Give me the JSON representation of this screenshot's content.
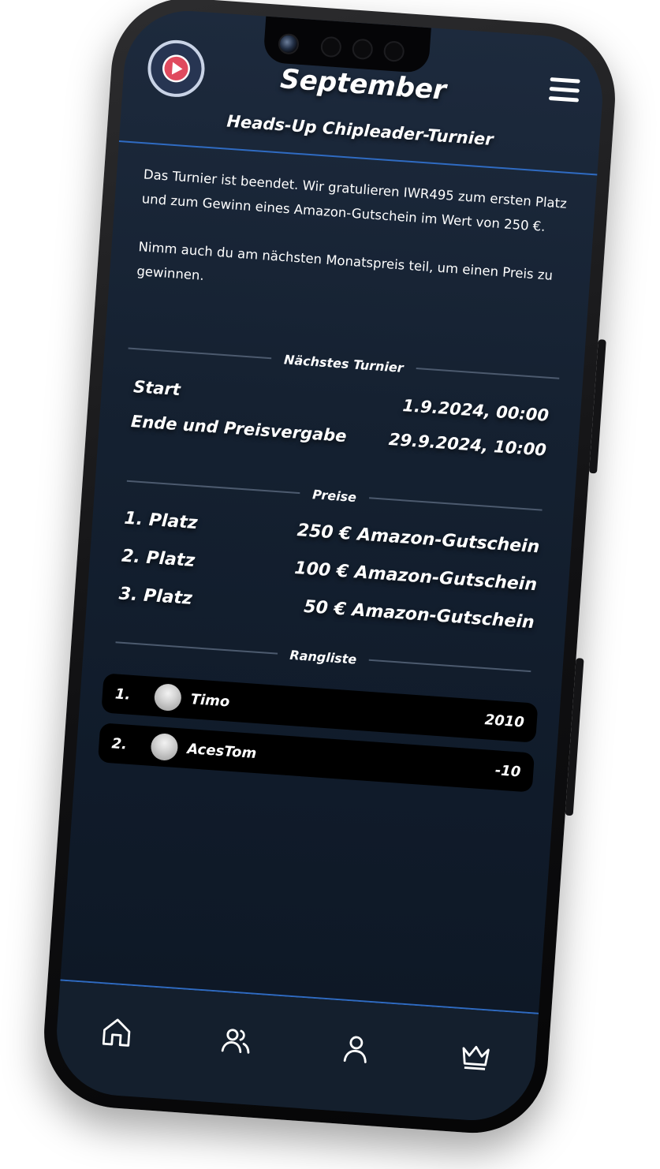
{
  "header": {
    "title": "September",
    "subtitle": "Heads-Up Chipleader-Turnier"
  },
  "intro": {
    "line1": "Das Turnier ist beendet. Wir gratulieren IWR495 zum ersten Platz und zum Gewinn eines Amazon-Gutschein im Wert von 250 €.",
    "line2": "Nimm auch du am nächsten Monatspreis teil, um einen Preis zu gewinnen."
  },
  "next": {
    "label": "Nächstes Turnier",
    "rows": [
      {
        "label": "Start",
        "value": "1.9.2024, 00:00"
      },
      {
        "label": "Ende und Preisvergabe",
        "value": "29.9.2024, 10:00"
      }
    ]
  },
  "prizes": {
    "label": "Preise",
    "items": [
      {
        "place": "1. Platz",
        "prize": "250 € Amazon-Gutschein"
      },
      {
        "place": "2. Platz",
        "prize": "100 € Amazon-Gutschein"
      },
      {
        "place": "3. Platz",
        "prize": "50 € Amazon-Gutschein"
      }
    ]
  },
  "leaderboard": {
    "label": "Rangliste",
    "rows": [
      {
        "rank": "1.",
        "name": "Timo",
        "score": "2010"
      },
      {
        "rank": "2.",
        "name": "AcesTom",
        "score": "-10"
      }
    ]
  },
  "tabbar": {
    "items": [
      {
        "icon": "home-icon"
      },
      {
        "icon": "friends-icon"
      },
      {
        "icon": "profile-icon"
      },
      {
        "icon": "crown-icon"
      }
    ]
  },
  "colors": {
    "accent": "#2f6bc2",
    "background": "#152131"
  }
}
